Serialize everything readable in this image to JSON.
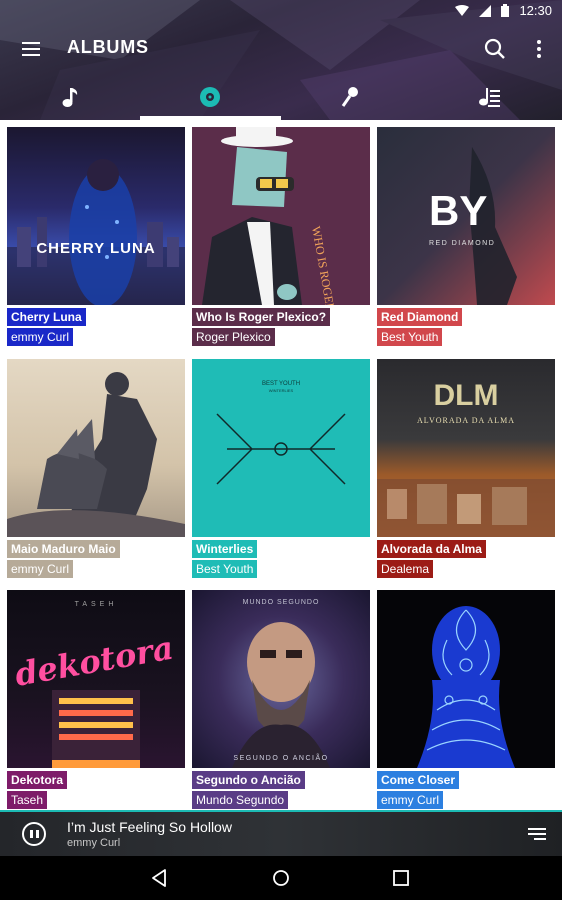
{
  "status_bar": {
    "time": "12:30",
    "icons": [
      "wifi-icon",
      "signal-icon",
      "battery-icon"
    ]
  },
  "toolbar": {
    "title": "ALBUMS",
    "icons": {
      "menu": "menu-icon",
      "search": "search-icon",
      "more": "more-vert-icon"
    }
  },
  "tabs": [
    {
      "id": "songs",
      "icon": "music-note-icon",
      "selected": false
    },
    {
      "id": "albums",
      "icon": "album-icon",
      "selected": true
    },
    {
      "id": "artists",
      "icon": "microphone-icon",
      "selected": false
    },
    {
      "id": "playlists",
      "icon": "playlist-icon",
      "selected": false
    }
  ],
  "albums": [
    {
      "title": "Cherry Luna",
      "artist": "emmy Curl",
      "color": "#1a28c8",
      "cover_text": "CHERRY LUNA"
    },
    {
      "title": "Who Is Roger Plexico?",
      "artist": "Roger Plexico",
      "color": "#5b2d4a",
      "cover_text": "WHO IS ROGER PLEXICO"
    },
    {
      "title": "Red Diamond",
      "artist": "Best Youth",
      "color": "#d1474c",
      "cover_text": "BY",
      "cover_subtext": "RED DIAMOND"
    },
    {
      "title": "Maio Maduro Maio",
      "artist": "emmy Curl",
      "color": "#b6aa98",
      "cover_text": ""
    },
    {
      "title": "Winterlies",
      "artist": "Best Youth",
      "color": "#1fbcb6",
      "cover_text": "BEST YOUTH",
      "cover_subtext": "WINTERLIES"
    },
    {
      "title": "Alvorada da Alma",
      "artist": "Dealema",
      "color": "#9c1c16",
      "cover_text": "DLM",
      "cover_subtext": "ALVORADA DA ALMA"
    },
    {
      "title": "Dekotora",
      "artist": "Taseh",
      "color": "#7e1c69",
      "cover_text": "dekotora",
      "cover_subtext": "TASEH"
    },
    {
      "title": "Segundo o Ancião",
      "artist": "Mundo Segundo",
      "color": "#5a3c86",
      "cover_text": "MUNDO SEGUNDO",
      "cover_subtext": "SEGUNDO O ANCIÃO"
    },
    {
      "title": "Come Closer",
      "artist": "emmy Curl",
      "color": "#2c7fe0",
      "cover_text": ""
    }
  ],
  "now_playing": {
    "song": "I’m Just Feeling So Hollow",
    "artist": "emmy Curl",
    "state": "playing",
    "accent": "#1cbbb4",
    "icons": {
      "control": "pause-icon",
      "queue": "queue-icon"
    }
  },
  "navbar": {
    "icons": [
      "back-icon",
      "home-icon",
      "recents-icon"
    ]
  },
  "colors": {
    "accent": "#1cbbb4",
    "header": "#2a2438"
  }
}
